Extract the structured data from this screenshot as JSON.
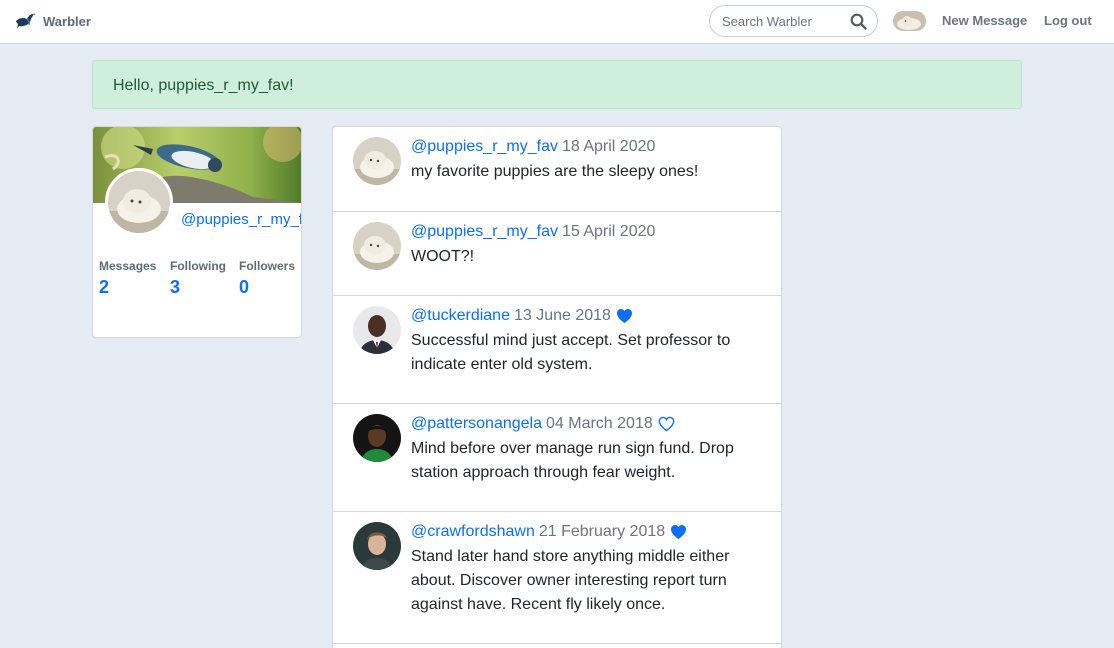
{
  "app": {
    "brand": "Warbler"
  },
  "nav": {
    "search_placeholder": "Search Warbler",
    "new_message": "New Message",
    "logout": "Log out"
  },
  "alert": {
    "text": "Hello, puppies_r_my_fav!"
  },
  "profile": {
    "username": "@puppies_r_my_fav",
    "stats": [
      {
        "label": "Messages",
        "value": "2"
      },
      {
        "label": "Following",
        "value": "3"
      },
      {
        "label": "Followers",
        "value": "0"
      }
    ]
  },
  "messages": [
    {
      "user": "@puppies_r_my_fav",
      "date": "18 April 2020",
      "text": "my favorite puppies are the sleepy ones!",
      "liked": null
    },
    {
      "user": "@puppies_r_my_fav",
      "date": "15 April 2020",
      "text": "WOOT?!",
      "liked": null
    },
    {
      "user": "@tuckerdiane",
      "date": "13 June 2018",
      "text": "Successful mind just accept. Set professor to indicate enter old system.",
      "liked": true
    },
    {
      "user": "@pattersonangela",
      "date": "04 March 2018",
      "text": "Mind before over manage run sign fund. Drop station approach through fear weight.",
      "liked": false
    },
    {
      "user": "@crawfordshawn",
      "date": "21 February 2018",
      "text": "Stand later hand store anything middle either about. Discover owner interesting report turn against have. Recent fly likely once.",
      "liked": true
    }
  ],
  "colors": {
    "accent": "#0d6efd",
    "alert_bg": "#d0eedc",
    "page_bg": "#e5ebf2"
  },
  "icons": {
    "brand": "bird-logo-icon",
    "search": "search-icon",
    "like": "heart-icon"
  }
}
